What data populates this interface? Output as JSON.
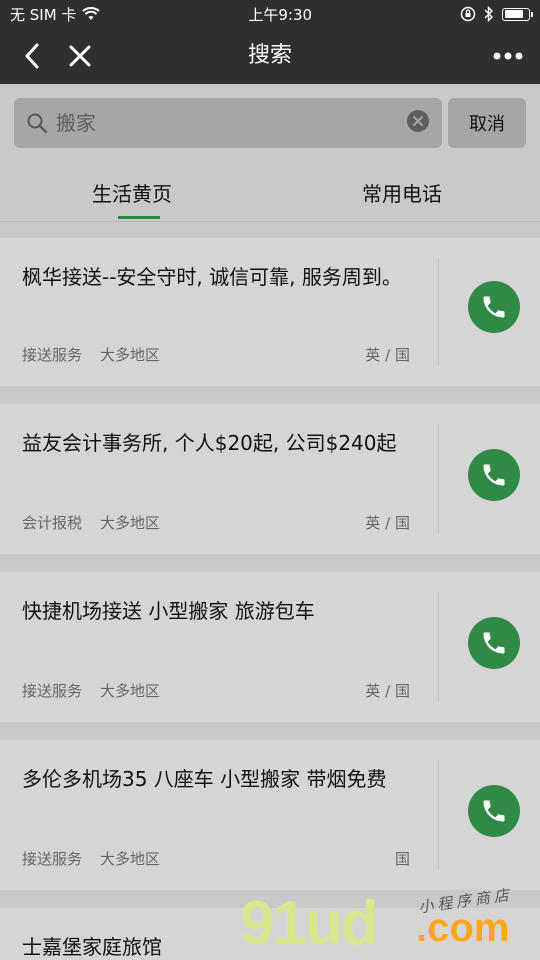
{
  "status_bar": {
    "carrier": "无 SIM 卡",
    "time": "上午9:30"
  },
  "nav": {
    "title": "搜索",
    "back_icon": "chevron-left-icon",
    "close_icon": "close-icon",
    "more_icon": "more-horizontal-icon"
  },
  "search": {
    "placeholder": "搬家",
    "cancel_label": "取消"
  },
  "tabs": [
    {
      "label": "生活黄页",
      "active": true
    },
    {
      "label": "常用电话",
      "active": false
    }
  ],
  "listings": [
    {
      "title": "枫华接送--安全守时, 诚信可靠, 服务周到。",
      "category": "接送服务",
      "area": "大多地区",
      "languages": "英 / 国"
    },
    {
      "title": "益友会计事务所, 个人$20起, 公司$240起",
      "category": "会计报税",
      "area": "大多地区",
      "languages": "英 / 国"
    },
    {
      "title": "快捷机场接送 小型搬家 旅游包车",
      "category": "接送服务",
      "area": "大多地区",
      "languages": "英 / 国"
    },
    {
      "title": "多伦多机场35 八座车 小型搬家 带烟免费",
      "category": "接送服务",
      "area": "大多地区",
      "languages": "国"
    },
    {
      "title": "士嘉堡家庭旅馆",
      "category": "",
      "area": "",
      "languages": ""
    }
  ],
  "watermark": {
    "main": "91ud",
    "suffix": ".com",
    "small": "小程序商店"
  },
  "colors": {
    "accent": "#2f8a45",
    "bar": "#2f2f2f",
    "background": "#c9c9c9"
  }
}
